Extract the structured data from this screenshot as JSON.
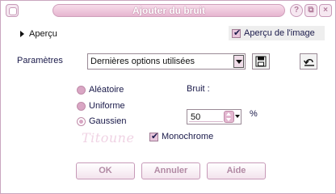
{
  "window": {
    "title": "Ajouter du bruit"
  },
  "titlebar": {
    "help_glyph": "?",
    "copy_glyph": "⧉",
    "close_glyph": "×"
  },
  "preview": {
    "toggle_label": "Aperçu",
    "image_preview_label": "Aperçu de l'image",
    "image_preview_checked": true
  },
  "params": {
    "label": "Paramètres",
    "preset_value": "Dernières options utilisées"
  },
  "distribution": {
    "options": [
      {
        "label": "Aléatoire",
        "checked": false
      },
      {
        "label": "Uniforme",
        "checked": false
      },
      {
        "label": "Gaussien",
        "checked": true
      }
    ]
  },
  "noise": {
    "label": "Bruit :",
    "value": "50",
    "unit": "%"
  },
  "monochrome": {
    "label": "Monochrome",
    "checked": true
  },
  "watermark": "Titoune",
  "buttons": {
    "ok": "OK",
    "cancel": "Annuler",
    "help": "Aide"
  },
  "colors": {
    "accent_pink": "#e3b7d0",
    "button_text": "#b28aa4",
    "label_text": "#1a1a4a"
  }
}
